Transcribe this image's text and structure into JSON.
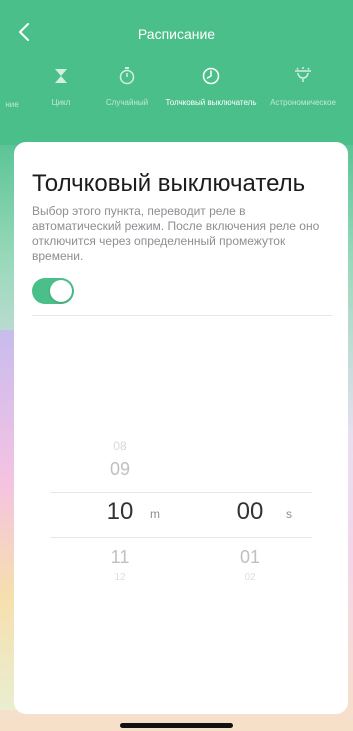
{
  "header": {
    "title": "Расписание",
    "tabs": [
      {
        "label": "ние",
        "icon": "calendar-icon",
        "active": false
      },
      {
        "label": "Цикл",
        "icon": "hourglass-icon",
        "active": false
      },
      {
        "label": "Случайный",
        "icon": "stopwatch-icon",
        "active": false
      },
      {
        "label": "Толчковый выключатель",
        "icon": "clock-icon",
        "active": true
      },
      {
        "label": "Астрономическое",
        "icon": "sun-icon",
        "active": false
      }
    ]
  },
  "card": {
    "title": "Толчковый выключатель",
    "description": "Выбор этого пункта, переводит реле в автоматический режим. После включения реле оно отключится через определенный промежуток времени.",
    "toggle_on": true
  },
  "picker": {
    "minutes": {
      "values": [
        "08",
        "09",
        "10",
        "11",
        "12"
      ],
      "selected": "10",
      "unit": "m"
    },
    "seconds": {
      "values": [
        "",
        "",
        "00",
        "01",
        "02"
      ],
      "selected": "00",
      "unit": "s"
    }
  },
  "colors": {
    "accent": "#4bbf8a"
  }
}
